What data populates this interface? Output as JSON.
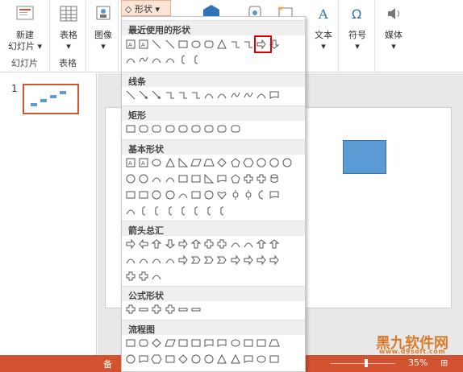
{
  "ribbon": {
    "groups": [
      {
        "label": "幻灯片",
        "button": "新建\n幻灯片 ▾"
      },
      {
        "label": "表格",
        "button": "表格\n▾"
      },
      {
        "label": "",
        "button": "图像\n▾"
      },
      {
        "label": "",
        "button": "文本\n▾"
      },
      {
        "label": "",
        "button": "符号\n▾"
      },
      {
        "label": "",
        "button": "媒体\n▾"
      }
    ],
    "shapes_button": "形状 ▾"
  },
  "thumbnails": {
    "slide_number": "1"
  },
  "shapes_panel": {
    "sections": [
      {
        "title": "最近使用的形状"
      },
      {
        "title": "线条"
      },
      {
        "title": "矩形"
      },
      {
        "title": "基本形状"
      },
      {
        "title": "箭头总汇"
      },
      {
        "title": "公式形状"
      },
      {
        "title": "流程图"
      }
    ]
  },
  "status": {
    "left": "备",
    "zoom": "35%"
  },
  "watermark": {
    "main": "黑九软件网",
    "sub": "www.d9soft.com"
  },
  "colors": {
    "accent": "#d35230",
    "shape_fill": "#5b9bd5"
  }
}
